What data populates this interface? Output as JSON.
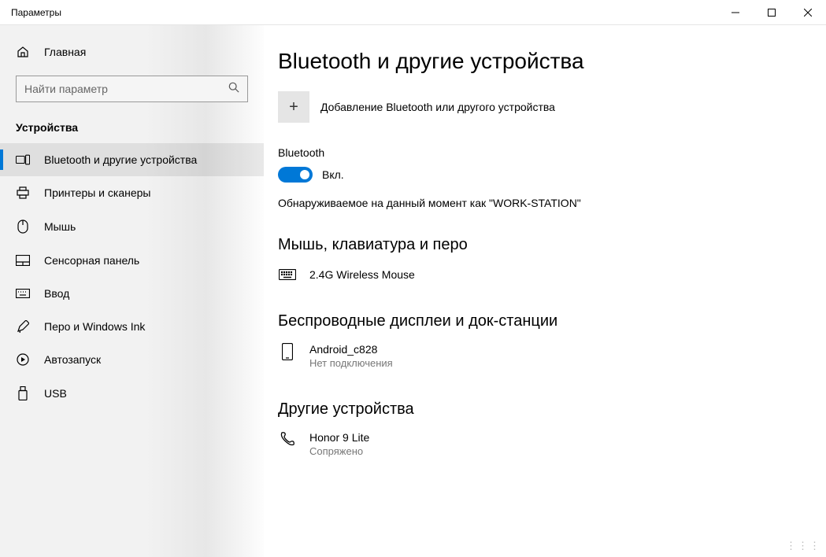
{
  "window": {
    "title": "Параметры"
  },
  "sidebar": {
    "home": "Главная",
    "search_placeholder": "Найти параметр",
    "category": "Устройства",
    "items": [
      {
        "label": "Bluetooth и другие устройства"
      },
      {
        "label": "Принтеры и сканеры"
      },
      {
        "label": "Мышь"
      },
      {
        "label": "Сенсорная панель"
      },
      {
        "label": "Ввод"
      },
      {
        "label": "Перо и Windows Ink"
      },
      {
        "label": "Автозапуск"
      },
      {
        "label": "USB"
      }
    ]
  },
  "main": {
    "title": "Bluetooth и другие устройства",
    "add_device": "Добавление Bluetooth или другого устройства",
    "bluetooth_label": "Bluetooth",
    "bluetooth_state": "Вкл.",
    "discoverable": "Обнаруживаемое на данный момент как \"WORK-STATION\"",
    "section_mouse": "Мышь, клавиатура и перо",
    "device_mouse": {
      "name": "2.4G Wireless Mouse"
    },
    "section_display": "Беспроводные дисплеи и док-станции",
    "device_display": {
      "name": "Android_c828",
      "status": "Нет подключения"
    },
    "section_other": "Другие устройства",
    "device_other": {
      "name": "Honor 9 Lite",
      "status": "Сопряжено"
    }
  }
}
